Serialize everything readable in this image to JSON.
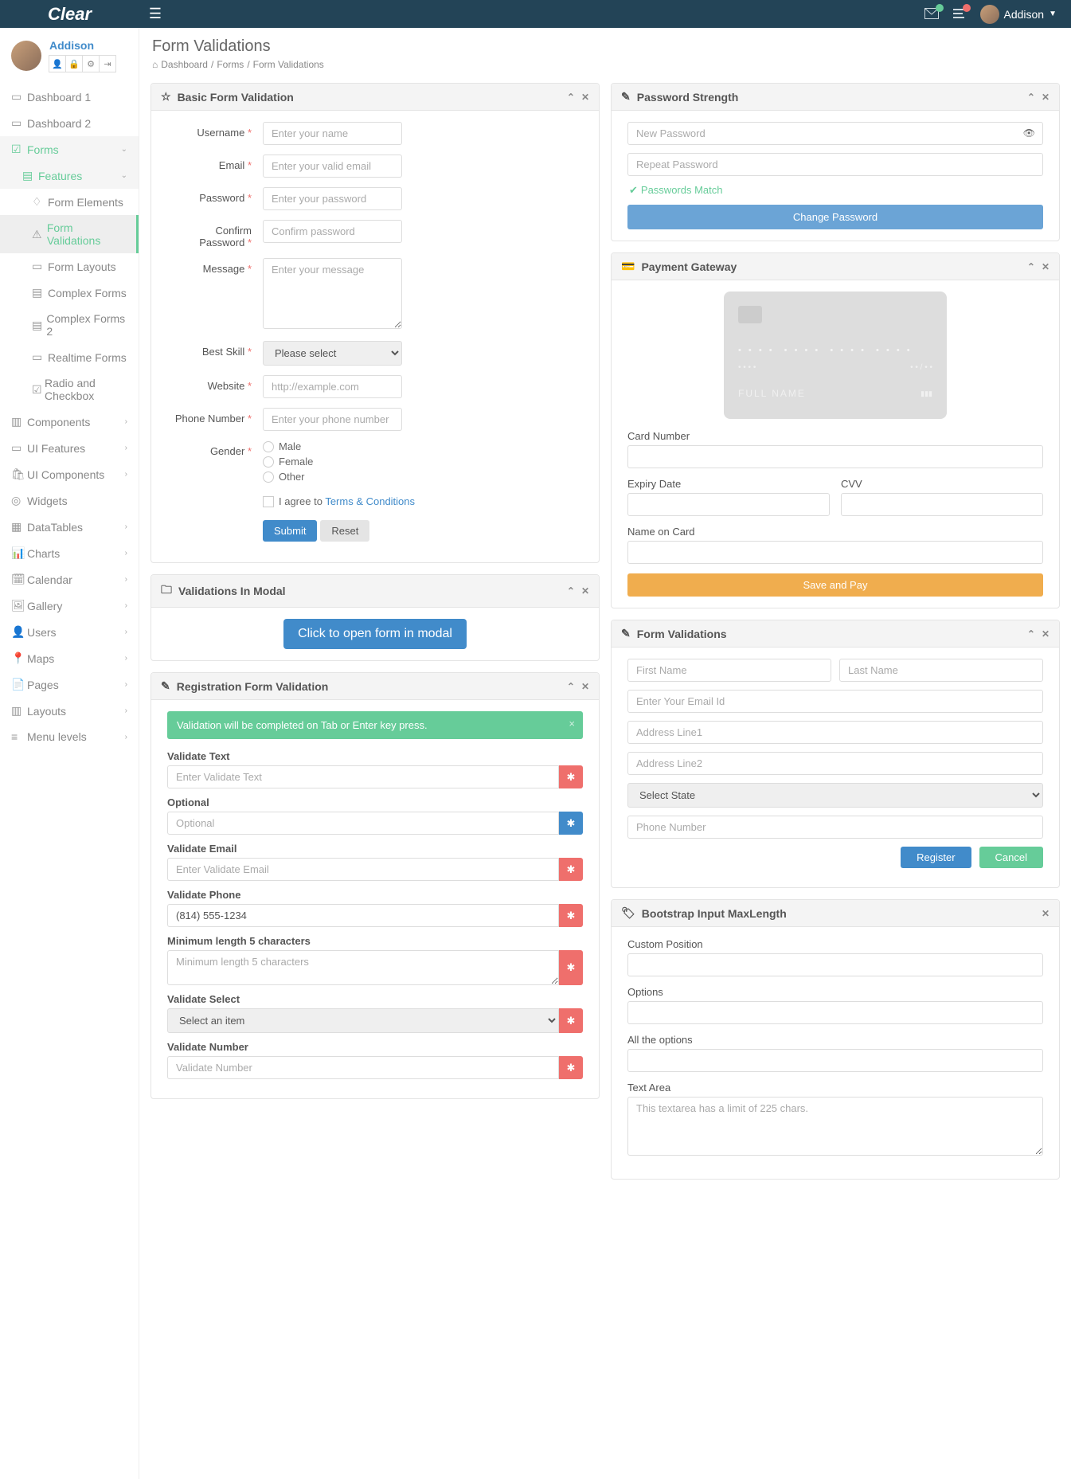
{
  "brand": "Clear",
  "user": {
    "name": "Addison"
  },
  "sidebar": {
    "items": [
      {
        "label": "Dashboard 1"
      },
      {
        "label": "Dashboard 2"
      },
      {
        "label": "Forms"
      },
      {
        "label": "Components"
      },
      {
        "label": "UI Features"
      },
      {
        "label": "UI Components"
      },
      {
        "label": "Widgets"
      },
      {
        "label": "DataTables"
      },
      {
        "label": "Charts"
      },
      {
        "label": "Calendar"
      },
      {
        "label": "Gallery"
      },
      {
        "label": "Users"
      },
      {
        "label": "Maps"
      },
      {
        "label": "Pages"
      },
      {
        "label": "Layouts"
      },
      {
        "label": "Menu levels"
      }
    ],
    "forms_sub": {
      "features": "Features"
    },
    "features_sub": [
      "Form Elements",
      "Form Validations",
      "Form Layouts",
      "Complex Forms",
      "Complex Forms 2",
      "Realtime Forms",
      "Radio and Checkbox"
    ]
  },
  "page": {
    "title": "Form Validations",
    "breadcrumb": [
      "Dashboard",
      "Forms",
      "Form Validations"
    ]
  },
  "basic": {
    "title": "Basic Form Validation",
    "labels": {
      "username": "Username",
      "email": "Email",
      "password": "Password",
      "confirm": "Confirm Password",
      "message": "Message",
      "skill": "Best Skill",
      "website": "Website",
      "phone": "Phone Number",
      "gender": "Gender"
    },
    "placeholders": {
      "username": "Enter your name",
      "email": "Enter your valid email",
      "password": "Enter your password",
      "confirm": "Confirm password",
      "message": "Enter your message",
      "website": "http://example.com",
      "phone": "Enter your phone number"
    },
    "skill_default": "Please select",
    "genders": [
      "Male",
      "Female",
      "Other"
    ],
    "agree_prefix": "I agree to ",
    "terms": "Terms & Conditions",
    "submit": "Submit",
    "reset": "Reset"
  },
  "modal": {
    "title": "Validations In Modal",
    "button": "Click to open form in modal"
  },
  "reg": {
    "title": "Registration Form Validation",
    "alert": "Validation will be completed on Tab or Enter key press.",
    "fields": {
      "validate_text": {
        "label": "Validate Text",
        "placeholder": "Enter Validate Text"
      },
      "optional": {
        "label": "Optional",
        "placeholder": "Optional"
      },
      "validate_email": {
        "label": "Validate Email",
        "placeholder": "Enter Validate Email"
      },
      "validate_phone": {
        "label": "Validate Phone",
        "value": "(814) 555-1234"
      },
      "minlen": {
        "label": "Minimum length 5 characters",
        "placeholder": "Minimum length 5 characters"
      },
      "validate_select": {
        "label": "Validate Select",
        "default": "Select an item"
      },
      "validate_number": {
        "label": "Validate Number",
        "placeholder": "Validate Number"
      }
    }
  },
  "pw": {
    "title": "Password Strength",
    "new": "New Password",
    "repeat": "Repeat Password",
    "match": "Passwords Match",
    "change": "Change Password"
  },
  "pay": {
    "title": "Payment Gateway",
    "card_name": "FULL  NAME",
    "labels": {
      "card": "Card Number",
      "expiry": "Expiry Date",
      "cvv": "CVV",
      "name": "Name on Card"
    },
    "save": "Save and Pay"
  },
  "fv": {
    "title": "Form Validations",
    "placeholders": {
      "first": "First Name",
      "last": "Last Name",
      "email": "Enter Your Email Id",
      "addr1": "Address Line1",
      "addr2": "Address Line2",
      "state": "Select State",
      "phone": "Phone Number"
    },
    "register": "Register",
    "cancel": "Cancel"
  },
  "maxlen": {
    "title": "Bootstrap Input MaxLength",
    "labels": {
      "custom": "Custom Position",
      "options": "Options",
      "all": "All the options",
      "textarea": "Text Area"
    },
    "ta_placeholder": "This textarea has a limit of 225 chars."
  }
}
